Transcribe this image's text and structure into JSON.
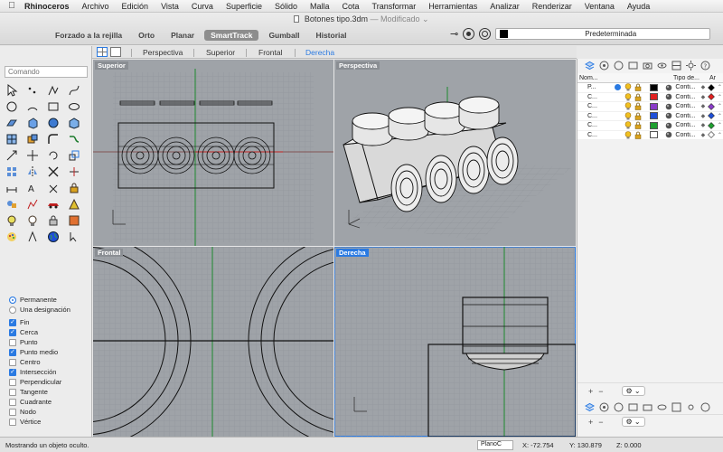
{
  "menubar": {
    "app": "Rhinoceros",
    "items": [
      "Archivo",
      "Edición",
      "Vista",
      "Curva",
      "Superficie",
      "Sólido",
      "Malla",
      "Cota",
      "Transformar",
      "Herramientas",
      "Analizar",
      "Renderizar",
      "Ventana",
      "Ayuda"
    ]
  },
  "window": {
    "doc_name": "Botones tipo.3dm",
    "doc_status": "Modificado"
  },
  "toolbar": {
    "tabs": [
      "Forzado a la rejilla",
      "Orto",
      "Planar",
      "SmartTrack",
      "Gumball",
      "Historial"
    ],
    "active_tab": "SmartTrack",
    "layer_value": "Predeterminada",
    "layer_color": "#000000"
  },
  "command": {
    "placeholder": "Comando"
  },
  "viewport_tabs": [
    "Perspectiva",
    "Superior",
    "Frontal",
    "Derecha"
  ],
  "active_viewport_tab": "Derecha",
  "viewports": {
    "top": "Superior",
    "perspective": "Perspectiva",
    "front": "Frontal",
    "right": "Derecha"
  },
  "osnap": {
    "modes": [
      {
        "label": "Permanente",
        "selected": true
      },
      {
        "label": "Una designación",
        "selected": false
      }
    ],
    "snaps": [
      {
        "label": "Fin",
        "checked": true
      },
      {
        "label": "Cerca",
        "checked": true
      },
      {
        "label": "Punto",
        "checked": false
      },
      {
        "label": "Punto medio",
        "checked": true
      },
      {
        "label": "Centro",
        "checked": false
      },
      {
        "label": "Intersección",
        "checked": true
      },
      {
        "label": "Perpendicular",
        "checked": false
      },
      {
        "label": "Tangente",
        "checked": false
      },
      {
        "label": "Cuadrante",
        "checked": false
      },
      {
        "label": "Nodo",
        "checked": false
      },
      {
        "label": "Vértice",
        "checked": false
      }
    ]
  },
  "layers": {
    "headers": {
      "name": "Nom...",
      "linetype": "Tipo de...",
      "print": "Ar"
    },
    "rows": [
      {
        "name": "P...",
        "current": true,
        "color": "#000000",
        "linetype": "Conti...",
        "print_color": "#000000"
      },
      {
        "name": "C...",
        "current": false,
        "color": "#e02020",
        "linetype": "Conti...",
        "print_color": "#e02020"
      },
      {
        "name": "C...",
        "current": false,
        "color": "#8a3cc8",
        "linetype": "Conti...",
        "print_color": "#8a3cc8"
      },
      {
        "name": "C...",
        "current": false,
        "color": "#1f4fd8",
        "linetype": "Conti...",
        "print_color": "#1f4fd8"
      },
      {
        "name": "C...",
        "current": false,
        "color": "#1fa030",
        "linetype": "Conti...",
        "print_color": "#1fa030"
      },
      {
        "name": "C...",
        "current": false,
        "color": "#ffffff",
        "linetype": "Conti...",
        "print_color": "#ffffff"
      }
    ]
  },
  "statusbar": {
    "message": "Mostrando un objeto oculto.",
    "cplane": "PlanoC",
    "x": "X: -72.754",
    "y": "Y: 130.879",
    "z": "Z: 0.000"
  },
  "colors": {
    "accent": "#2a7ae2",
    "viewport_bg": "#9fa3a8"
  }
}
